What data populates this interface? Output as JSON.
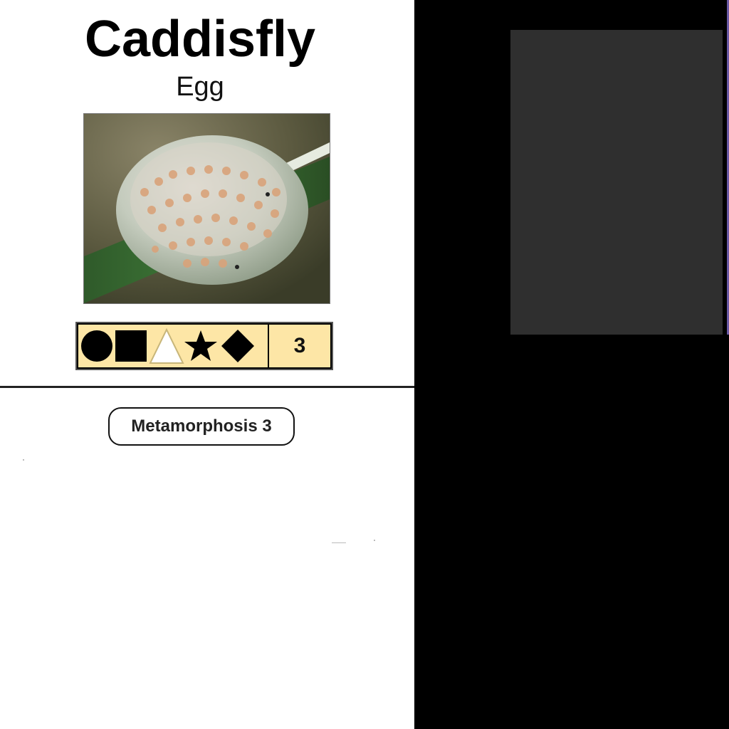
{
  "card": {
    "title": "Caddisfly",
    "subtitle": "Egg",
    "photo_subject": "caddisfly egg mass on leaf",
    "symbols": [
      "circle-icon",
      "square-icon",
      "triangle-outline-icon",
      "star-icon",
      "diamond-icon"
    ],
    "value": "3",
    "tag": "Metamorphosis 3"
  },
  "colors": {
    "symbol_bar_bg": "#fde6a6",
    "right_panel_bg": "#000000",
    "inner_box_bg": "#2f2f2f"
  }
}
